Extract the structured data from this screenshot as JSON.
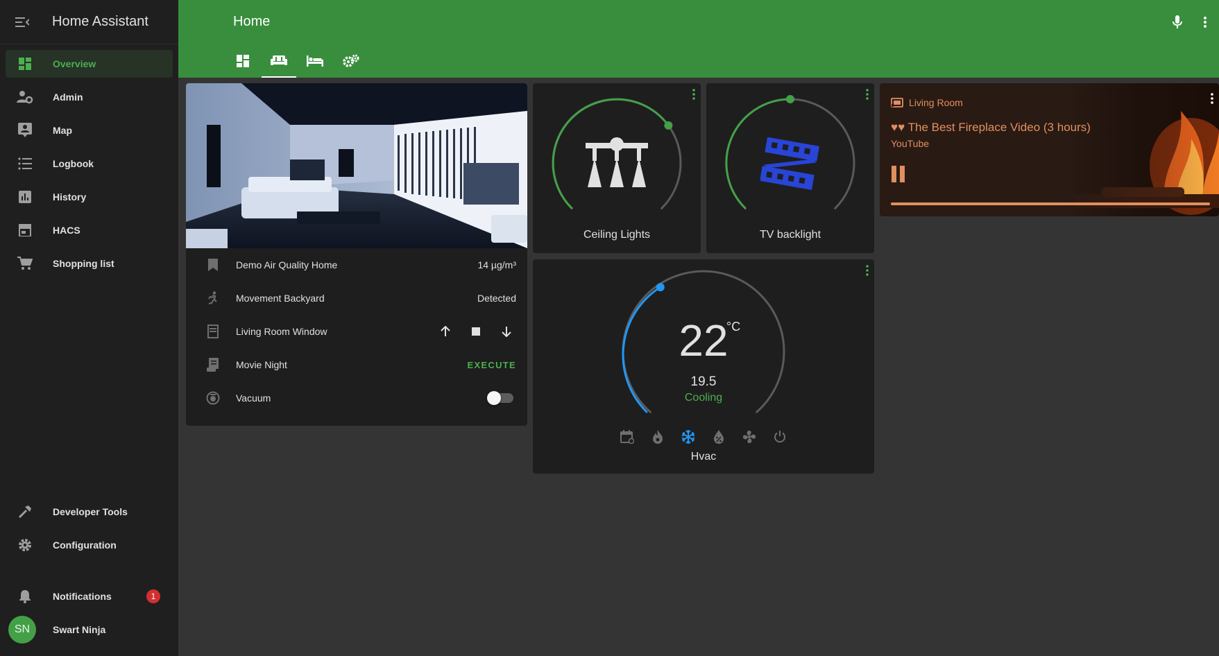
{
  "app": {
    "title": "Home Assistant"
  },
  "sidebar": {
    "items": [
      {
        "label": "Overview",
        "icon": "view-dashboard-icon"
      },
      {
        "label": "Admin",
        "icon": "account-cog-icon"
      },
      {
        "label": "Map",
        "icon": "map-account-icon"
      },
      {
        "label": "Logbook",
        "icon": "format-list-bulleted-icon"
      },
      {
        "label": "History",
        "icon": "chart-box-icon"
      },
      {
        "label": "HACS",
        "icon": "store-icon"
      },
      {
        "label": "Shopping list",
        "icon": "cart-icon"
      }
    ],
    "bottom_items": [
      {
        "label": "Developer Tools",
        "icon": "hammer-icon"
      },
      {
        "label": "Configuration",
        "icon": "cog-icon"
      }
    ],
    "notifications": {
      "label": "Notifications",
      "count": "1"
    },
    "user": {
      "initials": "SN",
      "name": "Swart Ninja"
    }
  },
  "header": {
    "title": "Home",
    "tabs": [
      "view-dashboard-icon",
      "sofa-icon",
      "bed-icon",
      "cogs-icon"
    ],
    "active_tab": 1
  },
  "entities": [
    {
      "name": "Demo Air Quality Home",
      "value": "14 µg/m³",
      "icon": "bookmark-icon"
    },
    {
      "name": "Movement Backyard",
      "value": "Detected",
      "icon": "run-icon"
    },
    {
      "name": "Living Room Window",
      "icon": "window-shutter-icon"
    },
    {
      "name": "Movie Night",
      "action": "EXECUTE",
      "icon": "script-text-icon"
    },
    {
      "name": "Vacuum",
      "icon": "robot-vacuum-icon",
      "toggle": false
    }
  ],
  "lights": [
    {
      "name": "Ceiling Lights",
      "brightness_percent": 70,
      "icon": "chandelier-icon"
    },
    {
      "name": "TV backlight",
      "brightness_percent": 50,
      "icon": "filmstrip-icon",
      "color": "#2845d6"
    }
  ],
  "thermostat": {
    "name": "Hvac",
    "current": "22",
    "unit": "°C",
    "target": "19.5",
    "action": "Cooling",
    "target_fraction": 0.38,
    "modes": [
      "calendar-sync-icon",
      "fire-icon",
      "snowflake-icon",
      "water-percent-icon",
      "fan-icon",
      "power-icon"
    ],
    "active_mode": "snowflake-icon"
  },
  "media": {
    "source": "Living Room",
    "title": "♥♥ The Best Fireplace Video (3 hours)",
    "app": "YouTube",
    "accent": "#e0905f"
  },
  "colors": {
    "primary": "#388e3c",
    "accent_green": "#4caf50",
    "cool_blue": "#2196f3"
  }
}
